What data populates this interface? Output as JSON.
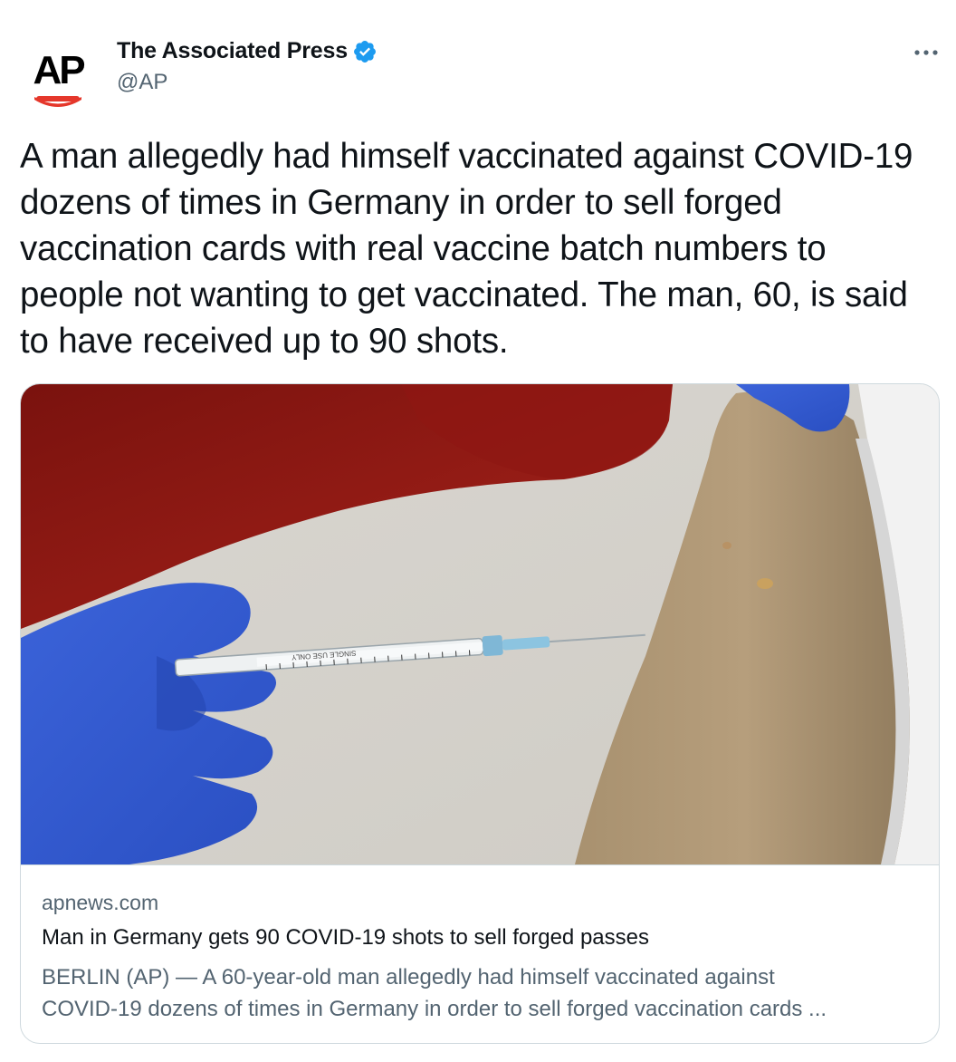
{
  "author": {
    "display_name": "The Associated Press",
    "handle": "@AP",
    "avatar_text": "AP",
    "verified": true,
    "avatar_icon": "ap-logo"
  },
  "menu": {
    "more_icon": "ellipsis-horizontal-icon"
  },
  "tweet": {
    "text": "A man allegedly had himself vaccinated against COVID-19 dozens of times in Germany in order to sell forged vaccination cards with real vaccine batch numbers to people not wanting to get vaccinated. The man, 60, is said to have received up to 90 shots."
  },
  "link_card": {
    "syringe_text": "SINGLE USE ONLY",
    "domain": "apnews.com",
    "title": "Man in Germany gets 90 COVID-19 shots to sell forged passes",
    "description_line1": "BERLIN (AP) — A 60-year-old man allegedly had himself vaccinated against",
    "description_line2": "COVID-19 dozens of times in Germany in order to sell forged vaccination cards ..."
  },
  "colors": {
    "verified_blue": "#1d9bf0",
    "ap_red": "#e5372b",
    "text_primary": "#0f1419",
    "text_secondary": "#536471",
    "border": "#cfd9de"
  }
}
